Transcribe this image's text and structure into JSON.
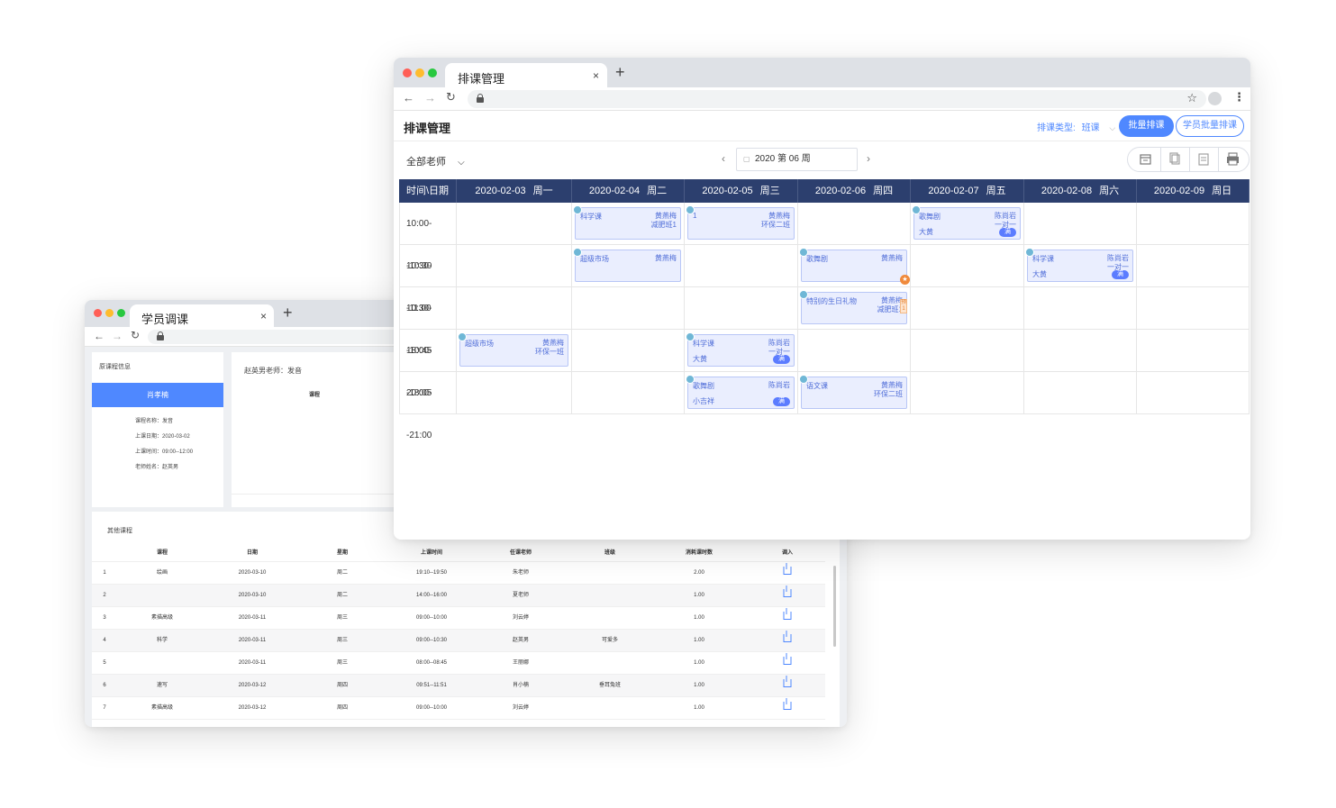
{
  "back_window": {
    "tab_title": "学员调课",
    "original_info": {
      "title": "原课程信息",
      "student": "肖孝楠",
      "fields": [
        "课程名称：发音",
        "上课日期：2020-03-02",
        "上课时间：09:00--12:00",
        "老师姓名：赵英男"
      ]
    },
    "teacher_panel": {
      "title": "赵英男老师：发音",
      "column": "课程"
    },
    "other_courses": {
      "title": "其他课程",
      "columns": [
        "课程",
        "日期",
        "星期",
        "上课时间",
        "任课老师",
        "班级",
        "消耗课时数",
        "调入"
      ],
      "rows": [
        {
          "no": "1",
          "course": "绘画",
          "date": "2020-03-10",
          "weekday": "周二",
          "time": "19:10--19:50",
          "teacher": "朱老师",
          "class": "",
          "hours": "2.00"
        },
        {
          "no": "2",
          "course": "",
          "date": "2020-03-10",
          "weekday": "周二",
          "time": "14:00--16:00",
          "teacher": "夏老师",
          "class": "",
          "hours": "1.00"
        },
        {
          "no": "3",
          "course": "素描高级",
          "date": "2020-03-11",
          "weekday": "周三",
          "time": "09:00--10:00",
          "teacher": "刘云婷",
          "class": "",
          "hours": "1.00"
        },
        {
          "no": "4",
          "course": "科学",
          "date": "2020-03-11",
          "weekday": "周三",
          "time": "09:00--10:30",
          "teacher": "赵英男",
          "class": "可爱多",
          "hours": "1.00"
        },
        {
          "no": "5",
          "course": "",
          "date": "2020-03-11",
          "weekday": "周三",
          "time": "08:00--08:45",
          "teacher": "王丽娜",
          "class": "",
          "hours": "1.00"
        },
        {
          "no": "6",
          "course": "速写",
          "date": "2020-03-12",
          "weekday": "周四",
          "time": "09:51--11:51",
          "teacher": "肖小楠",
          "class": "垂耳兔班",
          "hours": "1.00"
        },
        {
          "no": "7",
          "course": "素描高级",
          "date": "2020-03-12",
          "weekday": "周四",
          "time": "09:00--10:00",
          "teacher": "刘云婷",
          "class": "",
          "hours": "1.00"
        }
      ]
    }
  },
  "front_window": {
    "tab_title": "排课管理",
    "page_title": "排课管理",
    "schedule_type_label": "排课类型:",
    "schedule_type_value": "班课",
    "batch_button": "批量排课",
    "student_batch_button": "学员批量排课",
    "teacher_filter": "全部老师",
    "week_label": "2020 第 06 周",
    "tools": [
      "calendar-edit-icon",
      "copy-icon",
      "clipboard-icon",
      "print-icon"
    ],
    "corner_header": "时间\\日期",
    "days": [
      {
        "date": "2020-02-03",
        "weekday": "周一"
      },
      {
        "date": "2020-02-04",
        "weekday": "周二"
      },
      {
        "date": "2020-02-05",
        "weekday": "周三"
      },
      {
        "date": "2020-02-06",
        "weekday": "周四"
      },
      {
        "date": "2020-02-07",
        "weekday": "周五"
      },
      {
        "date": "2020-02-08",
        "weekday": "周六"
      },
      {
        "date": "2020-02-09",
        "weekday": "周日"
      }
    ],
    "time_slots": [
      "10:00--10:30",
      "10:30--11:00",
      "10:30--10:45",
      "18:00--18:05",
      "20:00--21:00"
    ],
    "events": [
      {
        "slot": 0,
        "day": 1,
        "name": "科学课",
        "teacher": "黄燕梅",
        "cls": "减肥班1",
        "room": "",
        "full": ""
      },
      {
        "slot": 0,
        "day": 2,
        "name": "1",
        "teacher": "黄燕梅",
        "cls": "环保二班",
        "room": "",
        "full": ""
      },
      {
        "slot": 0,
        "day": 4,
        "name": "歌舞剧",
        "teacher": "陈尚岩",
        "cls": "一对一",
        "room": "大黄",
        "full": "满"
      },
      {
        "slot": 1,
        "day": 1,
        "name": "超级市场",
        "teacher": "黄燕梅",
        "cls": "",
        "room": "",
        "full": ""
      },
      {
        "slot": 1,
        "day": 3,
        "name": "歌舞剧",
        "teacher": "黄燕梅",
        "cls": "",
        "room": "",
        "full": "",
        "star": "★"
      },
      {
        "slot": 1,
        "day": 5,
        "name": "科学课",
        "teacher": "陈尚岩",
        "cls": "一对一",
        "room": "大黄",
        "full": "满"
      },
      {
        "slot": 2,
        "day": 3,
        "name": "特别的生日礼物",
        "teacher": "黄燕梅",
        "cls": "减肥班1",
        "room": "",
        "full": "",
        "tag": "预1"
      },
      {
        "slot": 3,
        "day": 0,
        "name": "超级市场",
        "teacher": "黄燕梅",
        "cls": "环保一班",
        "room": "",
        "full": ""
      },
      {
        "slot": 3,
        "day": 2,
        "name": "科学课",
        "teacher": "陈尚岩",
        "cls": "一对一",
        "room": "大黄",
        "full": "满"
      },
      {
        "slot": 4,
        "day": 2,
        "name": "歌舞剧",
        "teacher": "陈尚岩",
        "cls": "",
        "room": "小吉祥",
        "full": "满"
      },
      {
        "slot": 4,
        "day": 3,
        "name": "语文课",
        "teacher": "黄燕梅",
        "cls": "环保二班",
        "room": "",
        "full": ""
      }
    ]
  },
  "colors": {
    "accent": "#4f88ff",
    "header_dark": "#2c3f6e",
    "event_bg": "#eaeefe",
    "event_text": "#4f6dd8"
  }
}
